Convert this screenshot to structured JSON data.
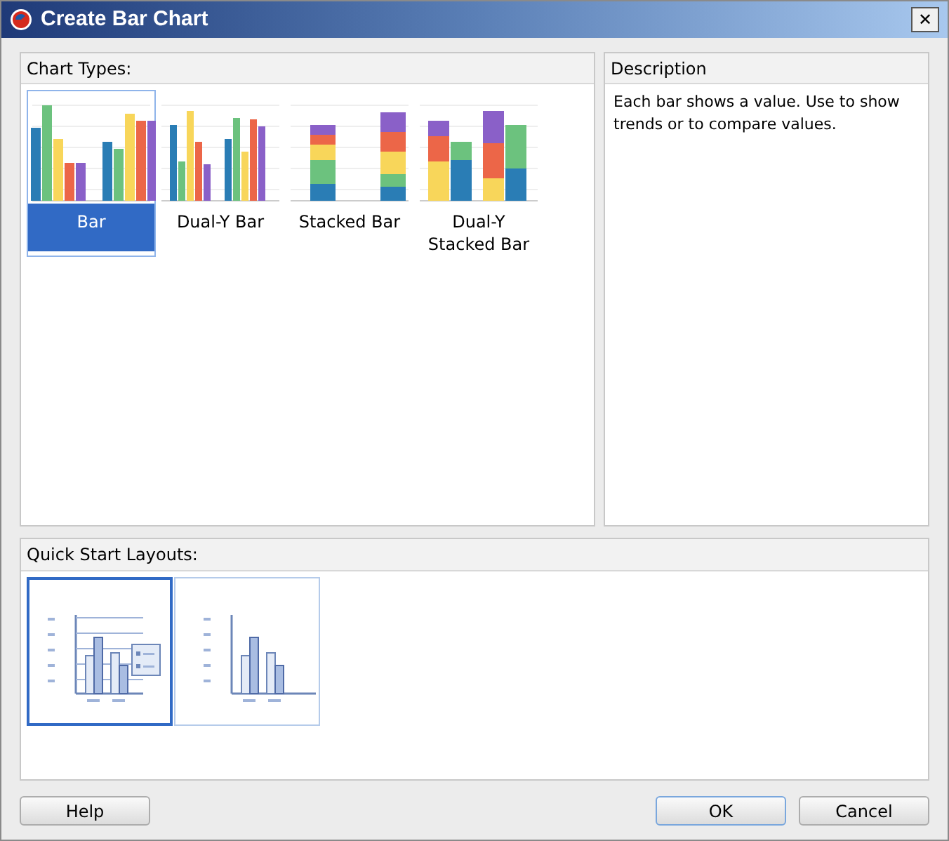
{
  "window": {
    "title": "Create  Bar Chart",
    "close": "✕"
  },
  "chart_types": {
    "title": "Chart Types:",
    "items": [
      {
        "kind": "bar",
        "label": "Bar",
        "selected": true
      },
      {
        "kind": "dual_y_bar",
        "label": "Dual-Y Bar",
        "selected": false
      },
      {
        "kind": "stacked",
        "label": "Stacked Bar",
        "selected": false
      },
      {
        "kind": "dual_y_stacked",
        "label": "Dual-Y Stacked Bar",
        "selected": false
      }
    ]
  },
  "description": {
    "title": "Description",
    "text": "Each bar shows a value. Use to show trends or to compare values."
  },
  "quick_start": {
    "title": "Quick Start Layouts:",
    "items": [
      {
        "kind": "legend",
        "selected": true
      },
      {
        "kind": "plain",
        "selected": false
      }
    ]
  },
  "left_buttons": [
    {
      "label": "Help",
      "default": false
    }
  ],
  "right_buttons": [
    {
      "label": "OK",
      "default": true
    },
    {
      "label": "Cancel",
      "default": false
    }
  ]
}
